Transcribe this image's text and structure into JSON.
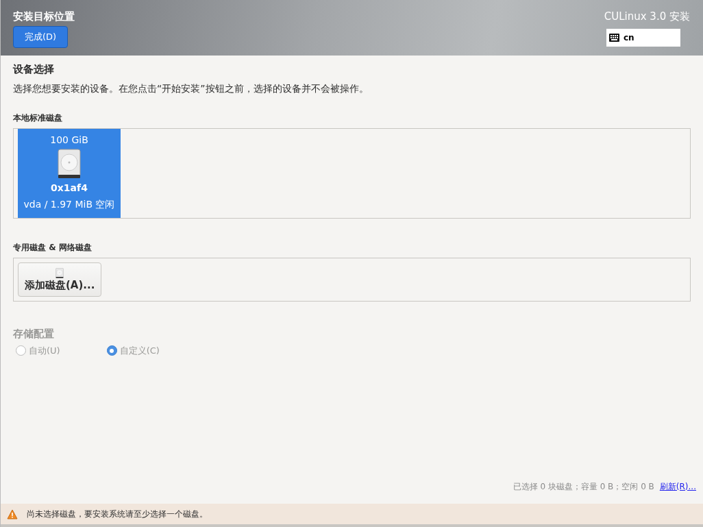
{
  "header": {
    "title": "安装目标位置",
    "done_button": "完成(D)",
    "product": "CULinux 3.0 安装",
    "keyboard_layout": "cn"
  },
  "device_selection": {
    "heading": "设备选择",
    "description": "选择您想要安装的设备。在您点击“开始安装”按钮之前，选择的设备并不会被操作。"
  },
  "local_disks": {
    "heading": "本地标准磁盘",
    "disks": [
      {
        "size": "100 GiB",
        "name": "0x1af4",
        "detail": "vda / 1.97 MiB 空闲",
        "selected": true
      }
    ]
  },
  "specialized_disks": {
    "heading": "专用磁盘 & 网络磁盘",
    "add_button": "添加磁盘(A)..."
  },
  "storage_config": {
    "heading": "存储配置",
    "disabled": true,
    "options": [
      {
        "label": "自动(U)",
        "selected": false
      },
      {
        "label": "自定义(C)",
        "selected": true
      }
    ]
  },
  "summary": {
    "text": "已选择 0 块磁盘；容量 0 B；空闲 0 B",
    "refresh_link": "刷新(R)..."
  },
  "warning": {
    "text": "尚未选择磁盘，要安装系统请至少选择一个磁盘。"
  }
}
